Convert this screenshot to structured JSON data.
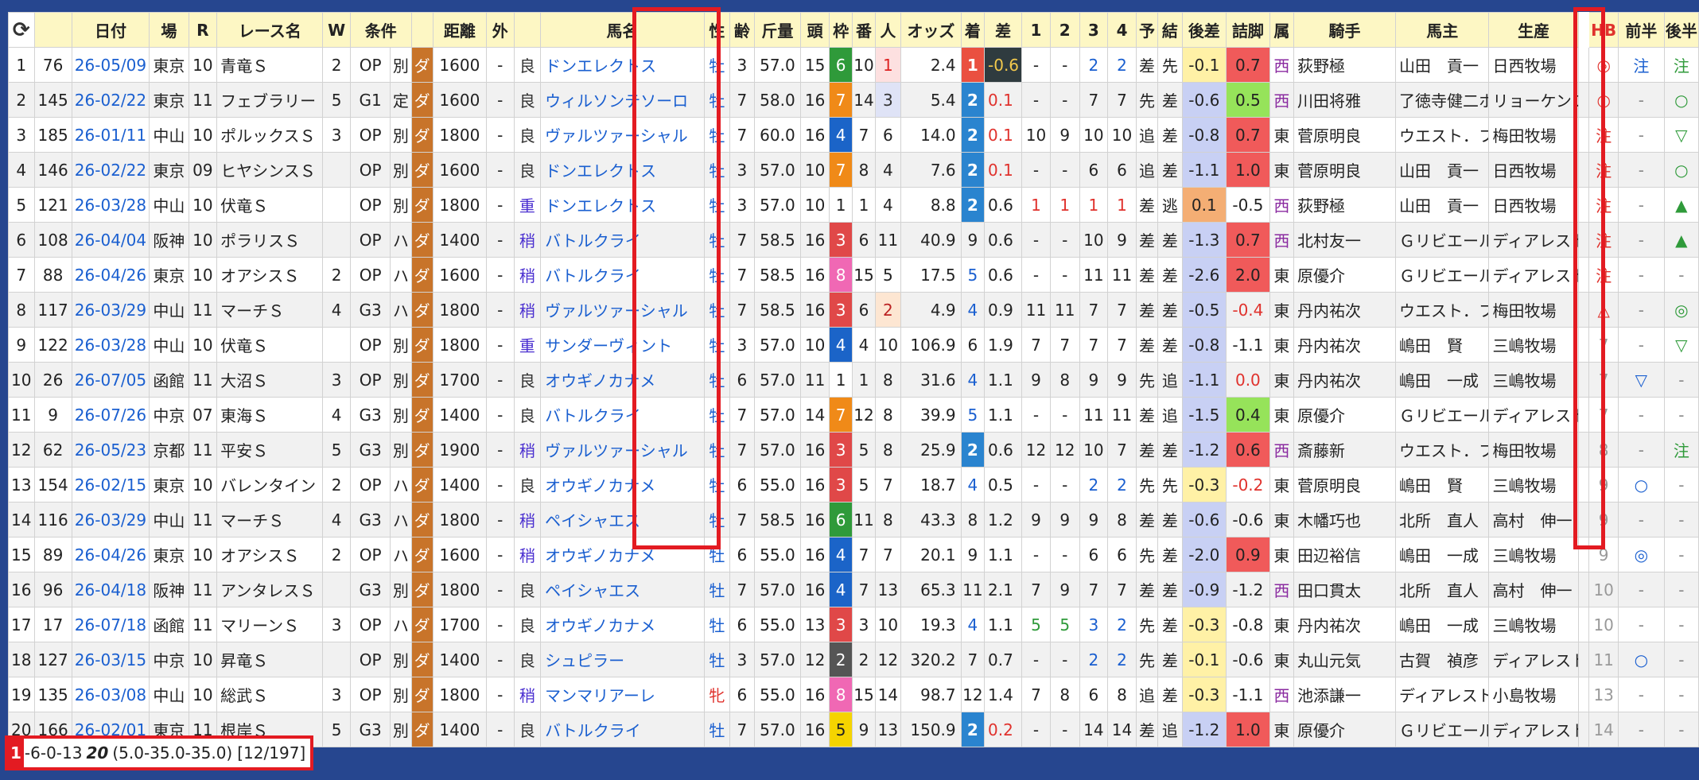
{
  "headers": {
    "reload": "C",
    "no": "",
    "idx": "",
    "date": "日付",
    "place": "場",
    "race_no": "R",
    "race_name": "レース名",
    "w": "W",
    "cond": "条件",
    "cond2": "",
    "surface": "",
    "distance": "距離",
    "outer": "外",
    "track": "",
    "horse": "馬名",
    "sex": "性",
    "age": "齢",
    "weight": "斤量",
    "heads": "頭",
    "waku": "枠",
    "umaban": "番",
    "pop": "人",
    "odds": "オッズ",
    "finish": "着",
    "diff": "差",
    "c1": "1",
    "c2": "2",
    "c3": "3",
    "c4": "4",
    "pred": "予",
    "result": "結",
    "ago_diff": "後差",
    "tsume": "詰脚",
    "zoku": "属",
    "jockey": "騎手",
    "owner": "馬主",
    "breeder": "生産",
    "blank": "",
    "hb": "HB",
    "first_half": "前半",
    "second_half": "後半"
  },
  "rows": [
    {
      "no": "1",
      "idx": "76",
      "date": "26-05/09",
      "place": "東京",
      "race_no": "10",
      "race_name": "青竜Ｓ",
      "w": "2",
      "cond": "OP",
      "cond2": "別",
      "surface": "ダ",
      "distance": "1600",
      "outer": "-",
      "track": "良",
      "horse": "ドンエレクトス",
      "sex": "牡",
      "age": "3",
      "weight": "57.0",
      "heads": "15",
      "waku": "6",
      "umaban": "10",
      "pop": "1",
      "odds": "2.4",
      "finish": "1",
      "diff": "-0.6",
      "c1": "-",
      "c2": "-",
      "c3": "2",
      "c4": "2",
      "pred": "差",
      "result": "先",
      "ago": "-0.1",
      "tsume": "0.7",
      "zoku": "西",
      "jockey": "荻野極",
      "owner": "山田　貢一",
      "breeder": "日西牧場",
      "hb": "◎",
      "fh": "注",
      "sh": "注"
    },
    {
      "no": "2",
      "idx": "145",
      "date": "26-02/22",
      "place": "東京",
      "race_no": "11",
      "race_name": "フェブラリー",
      "w": "5",
      "cond": "G1",
      "cond2": "定",
      "surface": "ダ",
      "distance": "1600",
      "outer": "-",
      "track": "良",
      "horse": "ウィルソンテソーロ",
      "sex": "牡",
      "age": "7",
      "weight": "58.0",
      "heads": "16",
      "waku": "7",
      "umaban": "14",
      "pop": "3",
      "odds": "5.4",
      "finish": "2",
      "diff": "0.1",
      "c1": "-",
      "c2": "-",
      "c3": "7",
      "c4": "7",
      "pred": "先",
      "result": "差",
      "ago": "-0.6",
      "tsume": "0.5",
      "zoku": "西",
      "jockey": "川田将雅",
      "owner": "了徳寺健二ホ",
      "breeder": "リョーケンフ",
      "hb": "○",
      "fh": "-",
      "sh": "○"
    },
    {
      "no": "3",
      "idx": "185",
      "date": "26-01/11",
      "place": "中山",
      "race_no": "10",
      "race_name": "ポルックスＳ",
      "w": "3",
      "cond": "OP",
      "cond2": "別",
      "surface": "ダ",
      "distance": "1800",
      "outer": "-",
      "track": "良",
      "horse": "ヴァルツァーシャル",
      "sex": "牡",
      "age": "7",
      "weight": "60.0",
      "heads": "16",
      "waku": "4",
      "umaban": "7",
      "pop": "6",
      "odds": "14.0",
      "finish": "2",
      "diff": "0.1",
      "c1": "10",
      "c2": "9",
      "c3": "10",
      "c4": "10",
      "pred": "追",
      "result": "差",
      "ago": "-0.8",
      "tsume": "0.7",
      "zoku": "東",
      "jockey": "菅原明良",
      "owner": "ウエスト．フ",
      "breeder": "梅田牧場",
      "hb": "注",
      "fh": "-",
      "sh": "▽"
    },
    {
      "no": "4",
      "idx": "146",
      "date": "26-02/22",
      "place": "東京",
      "race_no": "09",
      "race_name": "ヒヤシンスＳ",
      "w": "",
      "cond": "OP",
      "cond2": "別",
      "surface": "ダ",
      "distance": "1600",
      "outer": "-",
      "track": "良",
      "horse": "ドンエレクトス",
      "sex": "牡",
      "age": "3",
      "weight": "57.0",
      "heads": "10",
      "waku": "7",
      "umaban": "8",
      "pop": "4",
      "odds": "7.6",
      "finish": "2",
      "diff": "0.1",
      "c1": "-",
      "c2": "-",
      "c3": "6",
      "c4": "6",
      "pred": "追",
      "result": "差",
      "ago": "-1.1",
      "tsume": "1.0",
      "zoku": "東",
      "jockey": "菅原明良",
      "owner": "山田　貢一",
      "breeder": "日西牧場",
      "hb": "注",
      "fh": "-",
      "sh": "○"
    },
    {
      "no": "5",
      "idx": "121",
      "date": "26-03/28",
      "place": "中山",
      "race_no": "10",
      "race_name": "伏竜Ｓ",
      "w": "",
      "cond": "OP",
      "cond2": "別",
      "surface": "ダ",
      "distance": "1800",
      "outer": "-",
      "track": "重",
      "horse": "ドンエレクトス",
      "sex": "牡",
      "age": "3",
      "weight": "57.0",
      "heads": "10",
      "waku": "1",
      "umaban": "1",
      "pop": "4",
      "odds": "8.8",
      "finish": "2",
      "diff": "0.6",
      "c1": "1",
      "c2": "1",
      "c3": "1",
      "c4": "1",
      "pred": "差",
      "result": "逃",
      "ago": "0.1",
      "tsume": "-0.5",
      "zoku": "西",
      "jockey": "荻野極",
      "owner": "山田　貢一",
      "breeder": "日西牧場",
      "hb": "注",
      "fh": "-",
      "sh": "▲"
    },
    {
      "no": "6",
      "idx": "108",
      "date": "26-04/04",
      "place": "阪神",
      "race_no": "10",
      "race_name": "ポラリスＳ",
      "w": "",
      "cond": "OP",
      "cond2": "ハ",
      "surface": "ダ",
      "distance": "1400",
      "outer": "-",
      "track": "稍",
      "horse": "バトルクライ",
      "sex": "牡",
      "age": "7",
      "weight": "58.5",
      "heads": "16",
      "waku": "3",
      "umaban": "6",
      "pop": "11",
      "odds": "40.9",
      "finish": "9",
      "diff": "0.6",
      "c1": "-",
      "c2": "-",
      "c3": "10",
      "c4": "9",
      "pred": "差",
      "result": "差",
      "ago": "-1.3",
      "tsume": "0.7",
      "zoku": "西",
      "jockey": "北村友一",
      "owner": "Ｇリビエール",
      "breeder": "ディアレスト",
      "hb": "注",
      "fh": "-",
      "sh": "▲"
    },
    {
      "no": "7",
      "idx": "88",
      "date": "26-04/26",
      "place": "東京",
      "race_no": "10",
      "race_name": "オアシスＳ",
      "w": "2",
      "cond": "OP",
      "cond2": "ハ",
      "surface": "ダ",
      "distance": "1600",
      "outer": "-",
      "track": "稍",
      "horse": "バトルクライ",
      "sex": "牡",
      "age": "7",
      "weight": "58.5",
      "heads": "16",
      "waku": "8",
      "umaban": "15",
      "pop": "5",
      "odds": "17.5",
      "finish": "5",
      "diff": "0.6",
      "c1": "-",
      "c2": "-",
      "c3": "11",
      "c4": "11",
      "pred": "差",
      "result": "差",
      "ago": "-2.6",
      "tsume": "2.0",
      "zoku": "東",
      "jockey": "原優介",
      "owner": "Ｇリビエール",
      "breeder": "ディアレスト",
      "hb": "注",
      "fh": "-",
      "sh": "-"
    },
    {
      "no": "8",
      "idx": "117",
      "date": "26-03/29",
      "place": "中山",
      "race_no": "11",
      "race_name": "マーチＳ",
      "w": "4",
      "cond": "G3",
      "cond2": "ハ",
      "surface": "ダ",
      "distance": "1800",
      "outer": "-",
      "track": "稍",
      "horse": "ヴァルツァーシャル",
      "sex": "牡",
      "age": "7",
      "weight": "58.5",
      "heads": "16",
      "waku": "3",
      "umaban": "6",
      "pop": "2",
      "odds": "4.9",
      "finish": "4",
      "diff": "0.9",
      "c1": "11",
      "c2": "11",
      "c3": "7",
      "c4": "7",
      "pred": "差",
      "result": "差",
      "ago": "-0.5",
      "tsume": "-0.4",
      "zoku": "東",
      "jockey": "丹内祐次",
      "owner": "ウエスト．フ",
      "breeder": "梅田牧場",
      "hb": "△",
      "fh": "-",
      "sh": "◎"
    },
    {
      "no": "9",
      "idx": "122",
      "date": "26-03/28",
      "place": "中山",
      "race_no": "10",
      "race_name": "伏竜Ｓ",
      "w": "",
      "cond": "OP",
      "cond2": "別",
      "surface": "ダ",
      "distance": "1800",
      "outer": "-",
      "track": "重",
      "horse": "サンダーヴィント",
      "sex": "牡",
      "age": "3",
      "weight": "57.0",
      "heads": "10",
      "waku": "4",
      "umaban": "4",
      "pop": "10",
      "odds": "106.9",
      "finish": "6",
      "diff": "1.9",
      "c1": "7",
      "c2": "7",
      "c3": "7",
      "c4": "7",
      "pred": "差",
      "result": "差",
      "ago": "-0.8",
      "tsume": "-1.1",
      "zoku": "東",
      "jockey": "丹内祐次",
      "owner": "嶋田　賢",
      "breeder": "三嶋牧場",
      "hb": "7",
      "fh": "-",
      "sh": "▽"
    },
    {
      "no": "10",
      "idx": "26",
      "date": "26-07/05",
      "place": "函館",
      "race_no": "11",
      "race_name": "大沼Ｓ",
      "w": "3",
      "cond": "OP",
      "cond2": "別",
      "surface": "ダ",
      "distance": "1700",
      "outer": "-",
      "track": "良",
      "horse": "オウギノカナメ",
      "sex": "牡",
      "age": "6",
      "weight": "57.0",
      "heads": "11",
      "waku": "1",
      "umaban": "1",
      "pop": "8",
      "odds": "31.6",
      "finish": "4",
      "diff": "1.1",
      "c1": "9",
      "c2": "8",
      "c3": "9",
      "c4": "9",
      "pred": "先",
      "result": "追",
      "ago": "-1.1",
      "tsume": "0.0",
      "zoku": "東",
      "jockey": "丹内祐次",
      "owner": "嶋田　一成",
      "breeder": "三嶋牧場",
      "hb": "7",
      "fh": "▽",
      "sh": "-"
    },
    {
      "no": "11",
      "idx": "9",
      "date": "26-07/26",
      "place": "中京",
      "race_no": "07",
      "race_name": "東海Ｓ",
      "w": "4",
      "cond": "G3",
      "cond2": "別",
      "surface": "ダ",
      "distance": "1400",
      "outer": "-",
      "track": "良",
      "horse": "バトルクライ",
      "sex": "牡",
      "age": "7",
      "weight": "57.0",
      "heads": "14",
      "waku": "7",
      "umaban": "12",
      "pop": "8",
      "odds": "39.9",
      "finish": "5",
      "diff": "1.1",
      "c1": "-",
      "c2": "-",
      "c3": "11",
      "c4": "11",
      "pred": "差",
      "result": "追",
      "ago": "-1.5",
      "tsume": "0.4",
      "zoku": "東",
      "jockey": "原優介",
      "owner": "Ｇリビエール",
      "breeder": "ディアレスト",
      "hb": "7",
      "fh": "-",
      "sh": "-"
    },
    {
      "no": "12",
      "idx": "62",
      "date": "26-05/23",
      "place": "京都",
      "race_no": "11",
      "race_name": "平安Ｓ",
      "w": "5",
      "cond": "G3",
      "cond2": "別",
      "surface": "ダ",
      "distance": "1900",
      "outer": "-",
      "track": "稍",
      "horse": "ヴァルツァーシャル",
      "sex": "牡",
      "age": "7",
      "weight": "57.0",
      "heads": "16",
      "waku": "3",
      "umaban": "5",
      "pop": "8",
      "odds": "25.9",
      "finish": "2",
      "diff": "0.6",
      "c1": "12",
      "c2": "12",
      "c3": "10",
      "c4": "7",
      "pred": "差",
      "result": "差",
      "ago": "-1.2",
      "tsume": "0.6",
      "zoku": "西",
      "jockey": "斎藤新",
      "owner": "ウエスト．フ",
      "breeder": "梅田牧場",
      "hb": "8",
      "fh": "-",
      "sh": "注"
    },
    {
      "no": "13",
      "idx": "154",
      "date": "26-02/15",
      "place": "東京",
      "race_no": "10",
      "race_name": "バレンタイン",
      "w": "2",
      "cond": "OP",
      "cond2": "ハ",
      "surface": "ダ",
      "distance": "1400",
      "outer": "-",
      "track": "良",
      "horse": "オウギノカナメ",
      "sex": "牡",
      "age": "6",
      "weight": "55.0",
      "heads": "16",
      "waku": "3",
      "umaban": "5",
      "pop": "7",
      "odds": "18.7",
      "finish": "4",
      "diff": "0.5",
      "c1": "-",
      "c2": "-",
      "c3": "2",
      "c4": "2",
      "pred": "先",
      "result": "先",
      "ago": "-0.3",
      "tsume": "-0.2",
      "zoku": "東",
      "jockey": "菅原明良",
      "owner": "嶋田　賢",
      "breeder": "三嶋牧場",
      "hb": "9",
      "fh": "○",
      "sh": "-"
    },
    {
      "no": "14",
      "idx": "116",
      "date": "26-03/29",
      "place": "中山",
      "race_no": "11",
      "race_name": "マーチＳ",
      "w": "4",
      "cond": "G3",
      "cond2": "ハ",
      "surface": "ダ",
      "distance": "1800",
      "outer": "-",
      "track": "稍",
      "horse": "ペイシャエス",
      "sex": "牡",
      "age": "7",
      "weight": "58.5",
      "heads": "16",
      "waku": "6",
      "umaban": "11",
      "pop": "8",
      "odds": "43.3",
      "finish": "8",
      "diff": "1.2",
      "c1": "9",
      "c2": "9",
      "c3": "9",
      "c4": "8",
      "pred": "差",
      "result": "差",
      "ago": "-0.6",
      "tsume": "-0.6",
      "zoku": "東",
      "jockey": "木幡巧也",
      "owner": "北所　直人",
      "breeder": "高村　伸一",
      "hb": "9",
      "fh": "-",
      "sh": "-"
    },
    {
      "no": "15",
      "idx": "89",
      "date": "26-04/26",
      "place": "東京",
      "race_no": "10",
      "race_name": "オアシスＳ",
      "w": "2",
      "cond": "OP",
      "cond2": "ハ",
      "surface": "ダ",
      "distance": "1600",
      "outer": "-",
      "track": "稍",
      "horse": "オウギノカナメ",
      "sex": "牡",
      "age": "6",
      "weight": "55.0",
      "heads": "16",
      "waku": "4",
      "umaban": "7",
      "pop": "7",
      "odds": "20.1",
      "finish": "9",
      "diff": "1.1",
      "c1": "-",
      "c2": "-",
      "c3": "6",
      "c4": "6",
      "pred": "先",
      "result": "差",
      "ago": "-2.0",
      "tsume": "0.9",
      "zoku": "東",
      "jockey": "田辺裕信",
      "owner": "嶋田　一成",
      "breeder": "三嶋牧場",
      "hb": "9",
      "fh": "◎",
      "sh": "-"
    },
    {
      "no": "16",
      "idx": "96",
      "date": "26-04/18",
      "place": "阪神",
      "race_no": "11",
      "race_name": "アンタレスＳ",
      "w": "",
      "cond": "G3",
      "cond2": "別",
      "surface": "ダ",
      "distance": "1800",
      "outer": "-",
      "track": "良",
      "horse": "ペイシャエス",
      "sex": "牡",
      "age": "7",
      "weight": "57.0",
      "heads": "16",
      "waku": "4",
      "umaban": "7",
      "pop": "13",
      "odds": "65.3",
      "finish": "11",
      "diff": "2.1",
      "c1": "7",
      "c2": "9",
      "c3": "7",
      "c4": "7",
      "pred": "差",
      "result": "差",
      "ago": "-0.9",
      "tsume": "-1.2",
      "zoku": "西",
      "jockey": "田口貫太",
      "owner": "北所　直人",
      "breeder": "高村　伸一",
      "hb": "10",
      "fh": "-",
      "sh": "-"
    },
    {
      "no": "17",
      "idx": "17",
      "date": "26-07/18",
      "place": "函館",
      "race_no": "11",
      "race_name": "マリーンＳ",
      "w": "3",
      "cond": "OP",
      "cond2": "ハ",
      "surface": "ダ",
      "distance": "1700",
      "outer": "-",
      "track": "良",
      "horse": "オウギノカナメ",
      "sex": "牡",
      "age": "6",
      "weight": "55.0",
      "heads": "13",
      "waku": "3",
      "umaban": "3",
      "pop": "10",
      "odds": "19.3",
      "finish": "4",
      "diff": "1.1",
      "c1": "5",
      "c2": "5",
      "c3": "3",
      "c4": "2",
      "pred": "先",
      "result": "差",
      "ago": "-0.3",
      "tsume": "-0.8",
      "zoku": "東",
      "jockey": "丹内祐次",
      "owner": "嶋田　一成",
      "breeder": "三嶋牧場",
      "hb": "10",
      "fh": "-",
      "sh": "-"
    },
    {
      "no": "18",
      "idx": "127",
      "date": "26-03/15",
      "place": "中京",
      "race_no": "10",
      "race_name": "昇竜Ｓ",
      "w": "",
      "cond": "OP",
      "cond2": "別",
      "surface": "ダ",
      "distance": "1400",
      "outer": "-",
      "track": "良",
      "horse": "シュピラー",
      "sex": "牡",
      "age": "3",
      "weight": "57.0",
      "heads": "12",
      "waku": "2",
      "umaban": "2",
      "pop": "12",
      "odds": "320.2",
      "finish": "7",
      "diff": "0.7",
      "c1": "-",
      "c2": "-",
      "c3": "2",
      "c4": "2",
      "pred": "先",
      "result": "差",
      "ago": "-0.1",
      "tsume": "-0.6",
      "zoku": "東",
      "jockey": "丸山元気",
      "owner": "古賀　禎彦",
      "breeder": "ディアレスト",
      "hb": "11",
      "fh": "○",
      "sh": "-"
    },
    {
      "no": "19",
      "idx": "135",
      "date": "26-03/08",
      "place": "中山",
      "race_no": "10",
      "race_name": "総武Ｓ",
      "w": "3",
      "cond": "OP",
      "cond2": "別",
      "surface": "ダ",
      "distance": "1800",
      "outer": "-",
      "track": "稍",
      "horse": "マンマリアーレ",
      "sex": "牝",
      "age": "6",
      "weight": "55.0",
      "heads": "16",
      "waku": "8",
      "umaban": "15",
      "pop": "14",
      "odds": "98.7",
      "finish": "12",
      "diff": "1.4",
      "c1": "7",
      "c2": "8",
      "c3": "6",
      "c4": "8",
      "pred": "追",
      "result": "差",
      "ago": "-0.3",
      "tsume": "-1.1",
      "zoku": "西",
      "jockey": "池添謙一",
      "owner": "ディアレスト",
      "breeder": "小島牧場",
      "hb": "13",
      "fh": "-",
      "sh": "-"
    },
    {
      "no": "20",
      "idx": "166",
      "date": "26-02/01",
      "place": "東京",
      "race_no": "11",
      "race_name": "根岸Ｓ",
      "w": "5",
      "cond": "G3",
      "cond2": "別",
      "surface": "ダ",
      "distance": "1400",
      "outer": "-",
      "track": "良",
      "horse": "バトルクライ",
      "sex": "牡",
      "age": "7",
      "weight": "57.0",
      "heads": "16",
      "waku": "5",
      "umaban": "9",
      "pop": "13",
      "odds": "150.9",
      "finish": "2",
      "diff": "0.2",
      "c1": "-",
      "c2": "-",
      "c3": "14",
      "c4": "14",
      "pred": "差",
      "result": "追",
      "ago": "-1.2",
      "tsume": "1.0",
      "zoku": "東",
      "jockey": "原優介",
      "owner": "Ｇリビエール",
      "breeder": "ディアレスト",
      "hb": "14",
      "fh": "-",
      "sh": "-"
    }
  ],
  "summary": {
    "first": "1",
    "record": "-6-0-13",
    "count": "20",
    "range": "(5.0-35.0-35.0)",
    "ratio": "[12/197]"
  },
  "colors": {
    "background": "#26468f",
    "header": "#fdf7c4",
    "highlight_box": "#e31b22",
    "link": "#1a5fd0"
  }
}
